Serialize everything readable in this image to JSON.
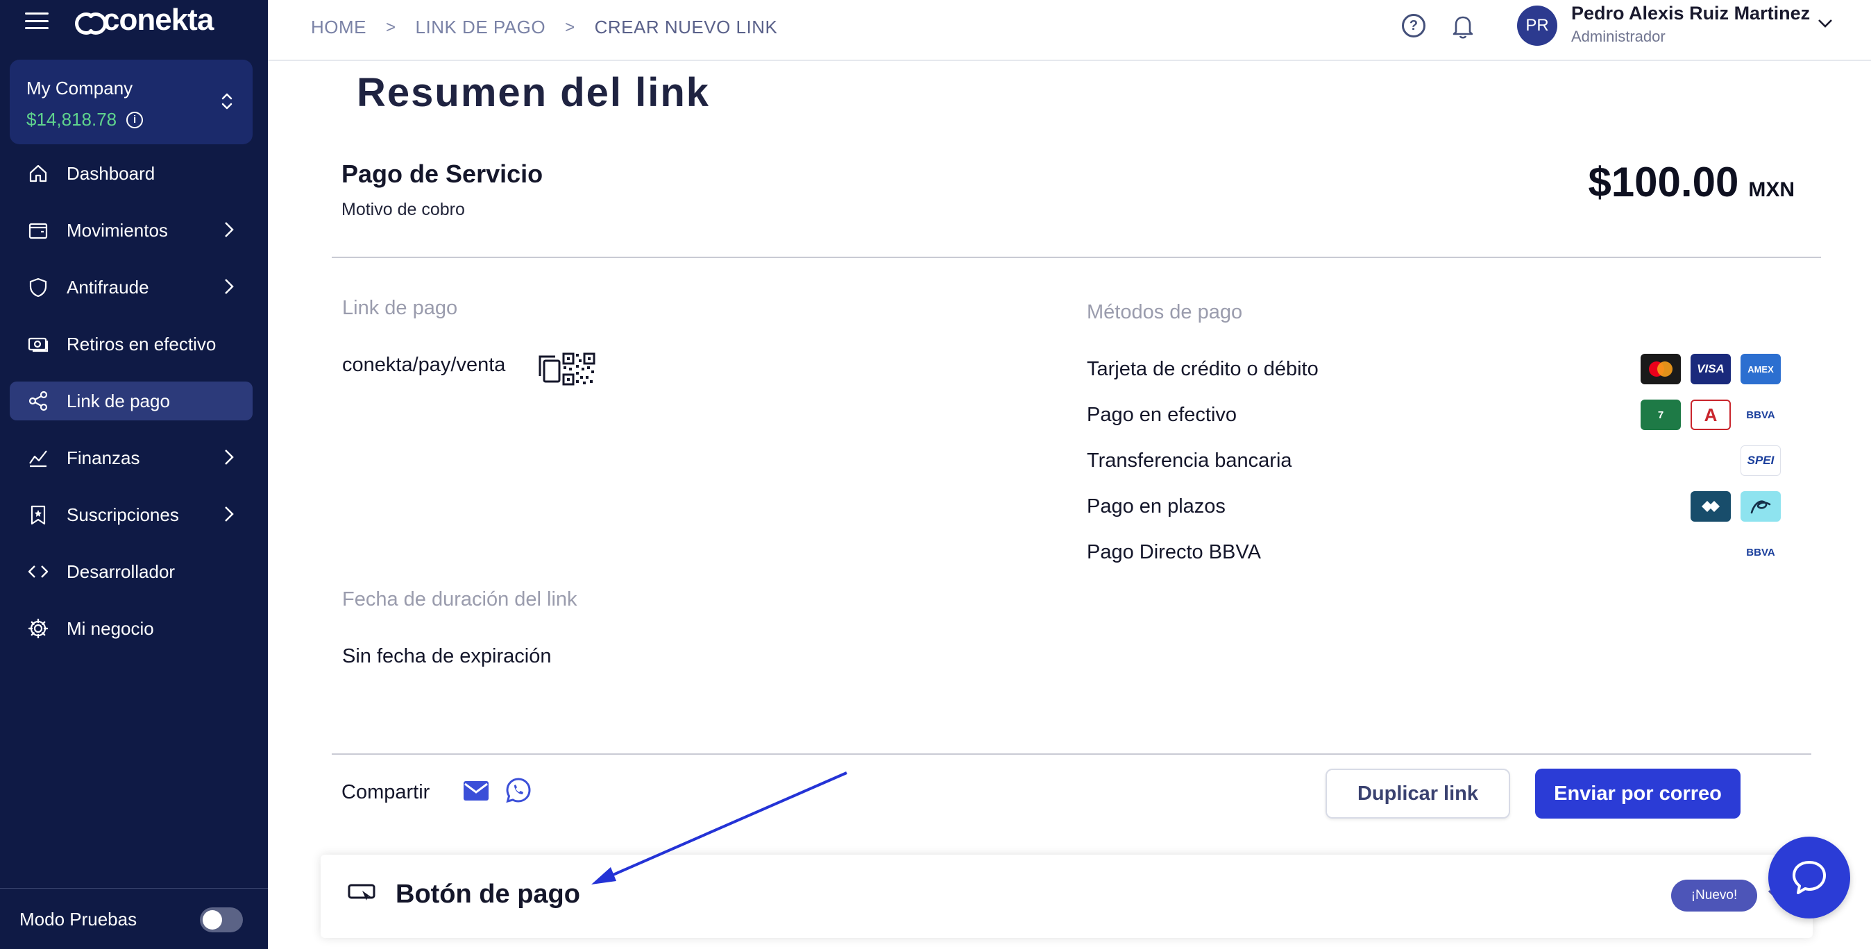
{
  "sidebar": {
    "brand": "conekta",
    "company": {
      "name": "My Company",
      "balance": "$14,818.78"
    },
    "items": [
      {
        "label": "Dashboard",
        "icon": "home-icon",
        "chevron": false,
        "active": false
      },
      {
        "label": "Movimientos",
        "icon": "wallet-icon",
        "chevron": true,
        "active": false
      },
      {
        "label": "Antifraude",
        "icon": "shield-icon",
        "chevron": true,
        "active": false
      },
      {
        "label": "Retiros en efectivo",
        "icon": "cash-icon",
        "chevron": false,
        "active": false
      },
      {
        "label": "Link de pago",
        "icon": "share-icon",
        "chevron": false,
        "active": true
      },
      {
        "label": "Finanzas",
        "icon": "chart-icon",
        "chevron": true,
        "active": false
      },
      {
        "label": "Suscripciones",
        "icon": "bookmark-icon",
        "chevron": true,
        "active": false
      },
      {
        "label": "Desarrollador",
        "icon": "code-icon",
        "chevron": false,
        "active": false
      },
      {
        "label": "Mi negocio",
        "icon": "gear-icon",
        "chevron": false,
        "active": false
      }
    ],
    "test_mode_label": "Modo Pruebas"
  },
  "header": {
    "breadcrumbs": [
      "HOME",
      "LINK DE PAGO",
      "CREAR NUEVO LINK"
    ],
    "user": {
      "initials": "PR",
      "name": "Pedro Alexis Ruiz Martinez",
      "role": "Administrador"
    }
  },
  "summary": {
    "title": "Resumen del link",
    "service_name": "Pago de Servicio",
    "service_desc": "Motivo de cobro",
    "amount": "$100.00",
    "currency": "MXN",
    "link_label": "Link de pago",
    "link_value": "conekta/pay/venta",
    "duration_label": "Fecha de duración del link",
    "duration_value": "Sin fecha de expiración",
    "methods_label": "Métodos de pago",
    "methods": [
      {
        "name": "Tarjeta de crédito o débito",
        "badges": [
          "mastercard",
          "VISA",
          "AMEX"
        ]
      },
      {
        "name": "Pago en efectivo",
        "badges": [
          "7",
          "A",
          "BBVA"
        ]
      },
      {
        "name": "Transferencia bancaria",
        "badges": [
          "SPEI"
        ]
      },
      {
        "name": "Pago en plazos",
        "badges": [
          "klar",
          "aplazo"
        ]
      },
      {
        "name": "Pago Directo BBVA",
        "badges": [
          "BBVA"
        ]
      }
    ]
  },
  "share": {
    "label": "Compartir",
    "duplicate_label": "Duplicar link",
    "send_label": "Enviar por correo"
  },
  "payment_button": {
    "title": "Botón de pago",
    "badge": "¡Nuevo!"
  },
  "colors": {
    "sidebar_bg": "#0f1a45",
    "accent": "#2b3cd6",
    "balance": "#5fd38d",
    "annotation_arrow": "#2433d6"
  }
}
